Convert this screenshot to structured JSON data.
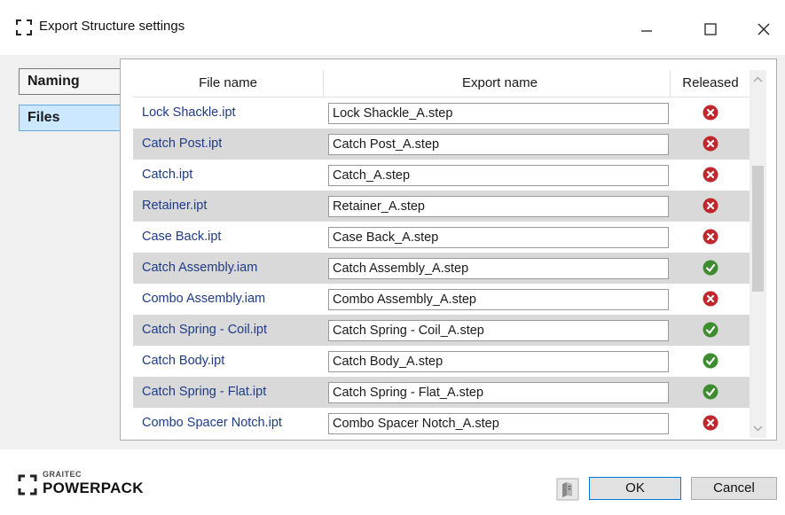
{
  "window": {
    "title": "Export Structure settings",
    "icon": "app-bracket-icon",
    "controls": [
      "minimize-icon",
      "maximize-icon",
      "close-icon"
    ]
  },
  "nav": {
    "naming_label": "Naming",
    "files_label": "Files",
    "selected": "Files"
  },
  "grid": {
    "headers": {
      "file_name": "File name",
      "export_name": "Export name",
      "released": "Released"
    },
    "rows": [
      {
        "file": "Lock Shackle.ipt",
        "export": "Lock Shackle_A.step",
        "released": false
      },
      {
        "file": "Catch Post.ipt",
        "export": "Catch Post_A.step",
        "released": false
      },
      {
        "file": "Catch.ipt",
        "export": "Catch_A.step",
        "released": false
      },
      {
        "file": "Retainer.ipt",
        "export": "Retainer_A.step",
        "released": false
      },
      {
        "file": "Case Back.ipt",
        "export": "Case Back_A.step",
        "released": false
      },
      {
        "file": "Catch Assembly.iam",
        "export": "Catch Assembly_A.step",
        "released": true
      },
      {
        "file": "Combo Assembly.iam",
        "export": "Combo Assembly_A.step",
        "released": false
      },
      {
        "file": "Catch Spring - Coil.ipt",
        "export": "Catch Spring - Coil_A.step",
        "released": true
      },
      {
        "file": "Catch Body.ipt",
        "export": "Catch Body_A.step",
        "released": true
      },
      {
        "file": "Catch Spring - Flat.ipt",
        "export": "Catch Spring - Flat_A.step",
        "released": true
      },
      {
        "file": "Combo Spacer Notch.ipt",
        "export": "Combo Spacer Notch_A.step",
        "released": false
      }
    ],
    "scroll_position": 0.45
  },
  "footer": {
    "logo_small": "GRAITEC",
    "logo_big": "POWERPACK",
    "help_icon": "help-book-icon",
    "ok_label": "OK",
    "cancel_label": "Cancel"
  },
  "colors": {
    "released_yes": "#3d8c2f",
    "released_no": "#c0282d",
    "file_text": "#1f3b86",
    "row_alt": "#d9d9d9",
    "selected_nav": "#cce8ff"
  }
}
